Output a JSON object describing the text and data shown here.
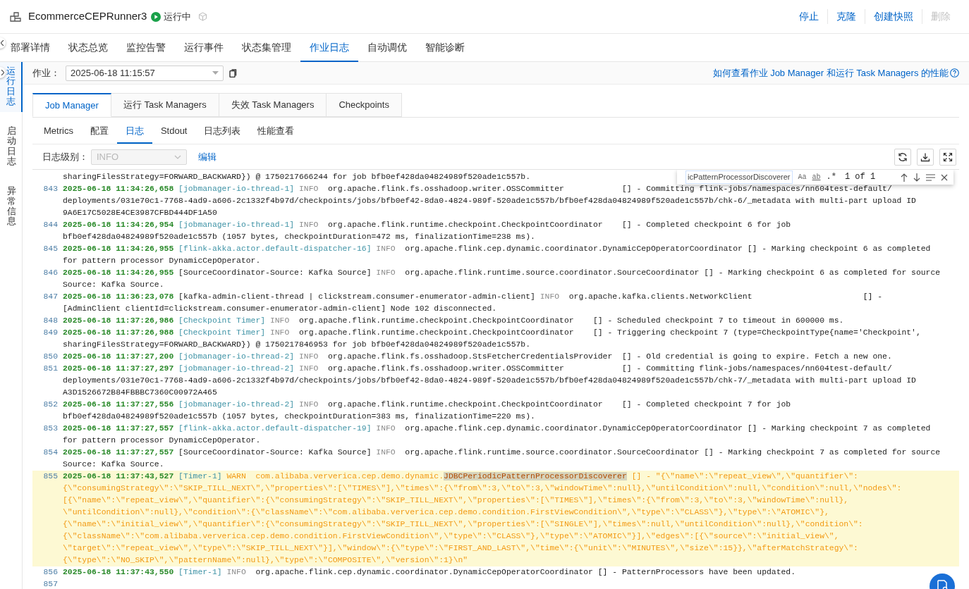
{
  "header": {
    "title": "EcommerceCEPRunner3",
    "status": {
      "label": "运行中"
    },
    "actions": [
      {
        "label": "停止",
        "disabled": false
      },
      {
        "label": "克隆",
        "disabled": false
      },
      {
        "label": "创建快照",
        "disabled": false
      },
      {
        "label": "删除",
        "disabled": true
      }
    ]
  },
  "tabs": [
    {
      "label": "部署详情",
      "selected": false
    },
    {
      "label": "状态总览",
      "selected": false
    },
    {
      "label": "监控告警",
      "selected": false
    },
    {
      "label": "运行事件",
      "selected": false
    },
    {
      "label": "状态集管理",
      "selected": false
    },
    {
      "label": "作业日志",
      "selected": true
    },
    {
      "label": "自动调优",
      "selected": false
    },
    {
      "label": "智能诊断",
      "selected": false
    }
  ],
  "side_tabs": [
    {
      "label": "运行日志",
      "selected": true
    },
    {
      "label": "启动日志",
      "selected": false
    },
    {
      "label": "异常信息",
      "selected": false
    }
  ],
  "job": {
    "label": "作业：",
    "value": "2025-06-18 11:15:57"
  },
  "help_link": "如何查看作业 Job Manager 和运行 Task Managers 的性能",
  "component_tabs": [
    {
      "label": "Job Manager",
      "selected": true
    },
    {
      "label": "运行 Task Managers",
      "selected": false
    },
    {
      "label": "失效 Task Managers",
      "selected": false
    },
    {
      "label": "Checkpoints",
      "selected": false
    }
  ],
  "sub_tabs": [
    {
      "label": "Metrics",
      "selected": false
    },
    {
      "label": "配置",
      "selected": false
    },
    {
      "label": "日志",
      "selected": true
    },
    {
      "label": "Stdout",
      "selected": false
    },
    {
      "label": "日志列表",
      "selected": false
    },
    {
      "label": "性能查看",
      "selected": false
    }
  ],
  "log_level": {
    "label": "日志级别：",
    "value": "INFO",
    "disabled": true
  },
  "edit_link": "编辑",
  "find": {
    "query": "icPatternProcessorDiscoverer",
    "match_case": "Aa",
    "whole_word": "ab",
    "regex": ".*",
    "count": "1 of 1"
  },
  "log": [
    {
      "lines": [
        "sharingFilesStrategy=FORWARD_BACKWARD}) @ 1750217666244 for job bfb0ef428da04824989f520ade1c557b."
      ]
    },
    {
      "number": "843",
      "timestamp": "2025-06-18 11:34:26,658",
      "thread": "[jobmanager-io-thread-1]",
      "thread_highlight": true,
      "level": "INFO",
      "message": "org.apache.flink.fs.osshadoop.writer.OSSCommitter            [] - Committing flink-jobs/namespaces/nn604test-default/",
      "lines": [
        "deployments/031e70c1-7768-4ad9-a606-2c1332f4b97d/checkpoints/jobs/bfb0ef42-8da0-4824-989f-520ade1c557b/bfb0ef428da04824989f520ade1c557b/chk-6/_metadata with multi-part upload ID",
        "9A6E17C5028E4CE3987CFBD444DF1A50"
      ]
    },
    {
      "number": "844",
      "timestamp": "2025-06-18 11:34:26,954",
      "thread": "[jobmanager-io-thread-1]",
      "thread_highlight": true,
      "level": "INFO",
      "message": "org.apache.flink.runtime.checkpoint.CheckpointCoordinator    [] - Completed checkpoint 6 for job",
      "lines": [
        "bfb0ef428da04824989f520ade1c557b (1057 bytes, checkpointDuration=472 ms, finalizationTime=238 ms)."
      ]
    },
    {
      "number": "845",
      "timestamp": "2025-06-18 11:34:26,955",
      "thread": "[flink-akka.actor.default-dispatcher-16]",
      "thread_highlight": true,
      "level": "INFO",
      "message": "org.apache.flink.cep.dynamic.coordinator.DynamicCepOperatorCoordinator [] - Marking checkpoint 6 as completed",
      "lines": [
        "for pattern processor DynamicCepOperator."
      ]
    },
    {
      "number": "846",
      "timestamp": "2025-06-18 11:34:26,955",
      "thread": "[SourceCoordinator-Source: Kafka Source]",
      "thread_highlight": false,
      "level": "INFO",
      "message": "org.apache.flink.runtime.source.coordinator.SourceCoordinator [] - Marking checkpoint 6 as completed for source",
      "lines": [
        "Source: Kafka Source."
      ]
    },
    {
      "number": "847",
      "timestamp": "2025-06-18 11:36:23,078",
      "thread": "[kafka-admin-client-thread | clickstream.consumer-enumerator-admin-client]",
      "thread_highlight": false,
      "level": "INFO",
      "message": "org.apache.kafka.clients.NetworkClient                       [] -",
      "lines": [
        "[AdminClient clientId=clickstream.consumer-enumerator-admin-client] Node 102 disconnected."
      ]
    },
    {
      "number": "848",
      "timestamp": "2025-06-18 11:37:26,986",
      "thread": "[Checkpoint Timer]",
      "thread_highlight": true,
      "level": "INFO",
      "message": "org.apache.flink.runtime.checkpoint.CheckpointCoordinator    [] - Scheduled checkpoint 7 to timeout in 600000 ms."
    },
    {
      "number": "849",
      "timestamp": "2025-06-18 11:37:26,988",
      "thread": "[Checkpoint Timer]",
      "thread_highlight": true,
      "level": "INFO",
      "message": "org.apache.flink.runtime.checkpoint.CheckpointCoordinator    [] - Triggering checkpoint 7 (type=CheckpointType{name='Checkpoint',",
      "lines": [
        "sharingFilesStrategy=FORWARD_BACKWARD}) @ 1750217846953 for job bfb0ef428da04824989f520ade1c557b."
      ]
    },
    {
      "number": "850",
      "timestamp": "2025-06-18 11:37:27,200",
      "thread": "[jobmanager-io-thread-2]",
      "thread_highlight": true,
      "level": "INFO",
      "message": "org.apache.flink.fs.osshadoop.StsFetcherCredentialsProvider  [] - Old credential is going to expire. Fetch a new one."
    },
    {
      "number": "851",
      "timestamp": "2025-06-18 11:37:27,297",
      "thread": "[jobmanager-io-thread-2]",
      "thread_highlight": true,
      "level": "INFO",
      "message": "org.apache.flink.fs.osshadoop.writer.OSSCommitter            [] - Committing flink-jobs/namespaces/nn604test-default/",
      "lines": [
        "deployments/031e70c1-7768-4ad9-a606-2c1332f4b97d/checkpoints/jobs/bfb0ef42-8da0-4824-989f-520ade1c557b/bfb0ef428da04824989f520ade1c557b/chk-7/_metadata with multi-part upload ID",
        "A3D1526672B84FBBBC7360C00972A465"
      ]
    },
    {
      "number": "852",
      "timestamp": "2025-06-18 11:37:27,556",
      "thread": "[jobmanager-io-thread-2]",
      "thread_highlight": true,
      "level": "INFO",
      "message": "org.apache.flink.runtime.checkpoint.CheckpointCoordinator    [] - Completed checkpoint 7 for job",
      "lines": [
        "bfb0ef428da04824989f520ade1c557b (1057 bytes, checkpointDuration=383 ms, finalizationTime=220 ms)."
      ]
    },
    {
      "number": "853",
      "timestamp": "2025-06-18 11:37:27,557",
      "thread": "[flink-akka.actor.default-dispatcher-19]",
      "thread_highlight": true,
      "level": "INFO",
      "message": "org.apache.flink.cep.dynamic.coordinator.DynamicCepOperatorCoordinator [] - Marking checkpoint 7 as completed",
      "lines": [
        "for pattern processor DynamicCepOperator."
      ]
    },
    {
      "number": "854",
      "timestamp": "2025-06-18 11:37:27,557",
      "thread": "[SourceCoordinator-Source: Kafka Source]",
      "thread_highlight": false,
      "level": "INFO",
      "message": "org.apache.flink.runtime.source.coordinator.SourceCoordinator [] - Marking checkpoint 7 as completed for source",
      "lines": [
        "Source: Kafka Source."
      ]
    },
    {
      "number": "855",
      "timestamp": "2025-06-18 11:37:43,527",
      "thread": "[Timer-1]",
      "thread_highlight": true,
      "level": "WARN",
      "message": "com.alibaba.ververica.cep.demo.dynamic.",
      "match": "JDBCPeriodicPatternProcessorDiscoverer",
      "message_after": " [] - \"{\\\"name\\\":\\\"repeat_view\\\",\\\"quantifier\\\":",
      "lines": [
        "{\\\"consumingStrategy\\\":\\\"SKIP_TILL_NEXT\\\",\\\"properties\\\":[\\\"TIMES\\\"],\\\"times\\\":{\\\"from\\\":3,\\\"to\\\":3,\\\"windowTime\\\":null},\\\"untilCondition\\\":null,\\\"condition\\\":null,\\\"nodes\\\":",
        "[{\\\"name\\\":\\\"repeat_view\\\",\\\"quantifier\\\":{\\\"consumingStrategy\\\":\\\"SKIP_TILL_NEXT\\\",\\\"properties\\\":[\\\"TIMES\\\"],\\\"times\\\":{\\\"from\\\":3,\\\"to\\\":3,\\\"windowTime\\\":null},",
        "\\\"untilCondition\\\":null},\\\"condition\\\":{\\\"className\\\":\\\"com.alibaba.ververica.cep.demo.condition.FirstViewCondition\\\",\\\"type\\\":\\\"CLASS\\\"},\\\"type\\\":\\\"ATOMIC\\\"},",
        "{\\\"name\\\":\\\"initial_view\\\",\\\"quantifier\\\":{\\\"consumingStrategy\\\":\\\"SKIP_TILL_NEXT\\\",\\\"properties\\\":[\\\"SINGLE\\\"],\\\"times\\\":null,\\\"untilCondition\\\":null},\\\"condition\\\":",
        "{\\\"className\\\":\\\"com.alibaba.ververica.cep.demo.condition.FirstViewCondition\\\",\\\"type\\\":\\\"CLASS\\\"},\\\"type\\\":\\\"ATOMIC\\\"}],\\\"edges\\\":[{\\\"source\\\":\\\"initial_view\\\",",
        "\\\"target\\\":\\\"repeat_view\\\",\\\"type\\\":\\\"SKIP_TILL_NEXT\\\"}],\\\"window\\\":{\\\"type\\\":\\\"FIRST_AND_LAST\\\",\\\"time\\\":{\\\"unit\\\":\\\"MINUTES\\\",\\\"size\\\":15}},\\\"afterMatchStrategy\\\":",
        "{\\\"type\\\":\\\"NO_SKIP\\\",\\\"patternName\\\":null},\\\"type\\\":\\\"COMPOSITE\\\",\\\"version\\\":1}\\n\""
      ]
    },
    {
      "number": "856",
      "timestamp": "2025-06-18 11:37:43,550",
      "thread": "[Timer-1]",
      "thread_highlight": true,
      "level": "INFO",
      "message": "org.apache.flink.cep.dynamic.coordinator.DynamicCepOperatorCoordinator [] - PatternProcessors have been updated."
    },
    {
      "number": "857"
    }
  ]
}
